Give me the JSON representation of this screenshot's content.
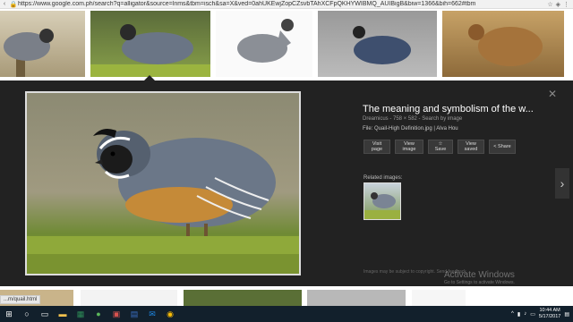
{
  "browser": {
    "url": "https://www.google.com.ph/search?q=alligator&source=lnms&tbm=isch&sa=X&ved=0ahUKEwjZopCZsvbTAhXCFpQKHYWIBMQ_AUIBigB&biw=1366&bih=662#tbm"
  },
  "preview": {
    "title": "The meaning and symbolism of the w...",
    "meta": "Dreamicus - 758 × 582 - Search by image",
    "file_label": "File:",
    "file_name": "Quail-High Definition.jpg | Alva Hou",
    "buttons": [
      {
        "label": "Visit page"
      },
      {
        "label": "View image"
      },
      {
        "label": "☆ Save"
      },
      {
        "label": "View saved"
      },
      {
        "label": "Share"
      }
    ],
    "related_label": "Related images:",
    "copyright": "Images may be subject to copyright.",
    "feedback": "Send feedback"
  },
  "watermark": {
    "title": "Activate Windows",
    "sub": "Go to Settings to activate Windows."
  },
  "status_url": "...m/quail.html",
  "taskbar": {
    "time": "10:44 AM",
    "date": "5/17/2017"
  },
  "icons": {
    "close": "close-icon",
    "next": "chevron-right-icon"
  }
}
